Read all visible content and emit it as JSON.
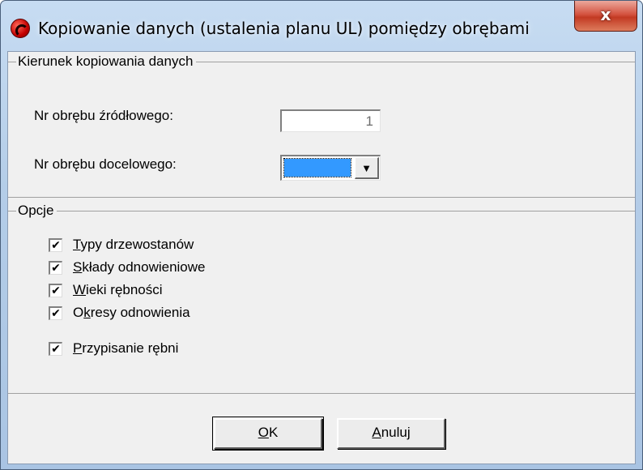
{
  "window": {
    "title": "Kopiowanie danych (ustalenia planu UL) pomiędzy obrębami",
    "close_label": "x"
  },
  "direction_group": {
    "legend": "Kierunek kopiowania danych",
    "source_label": "Nr obrębu źródłowego:",
    "source_value": "1",
    "target_label": "Nr obrębu docelowego:",
    "target_value": "",
    "target_highlight_color": "#3399ff",
    "dropdown_icon": "triangle-down-icon"
  },
  "options_group": {
    "legend": "Opcje",
    "items": [
      {
        "mnemonic": "T",
        "rest": "ypy drzewostanów",
        "checked": true,
        "mark": "✔"
      },
      {
        "mnemonic": "S",
        "rest": "kłady odnowieniowe",
        "checked": true,
        "mark": "✔"
      },
      {
        "mnemonic": "W",
        "rest": "ieki rębności",
        "checked": true,
        "mark": "✔"
      },
      {
        "prefix": "O",
        "mnemonic": "k",
        "rest": "resy odnowienia",
        "checked": true,
        "mark": "✔"
      },
      {
        "mnemonic": "P",
        "rest": "rzypisanie rębni",
        "checked": true,
        "mark": "✔"
      }
    ]
  },
  "buttons": {
    "ok_mnemonic": "O",
    "ok_rest": "K",
    "cancel_mnemonic": "A",
    "cancel_rest": "nuluj"
  }
}
